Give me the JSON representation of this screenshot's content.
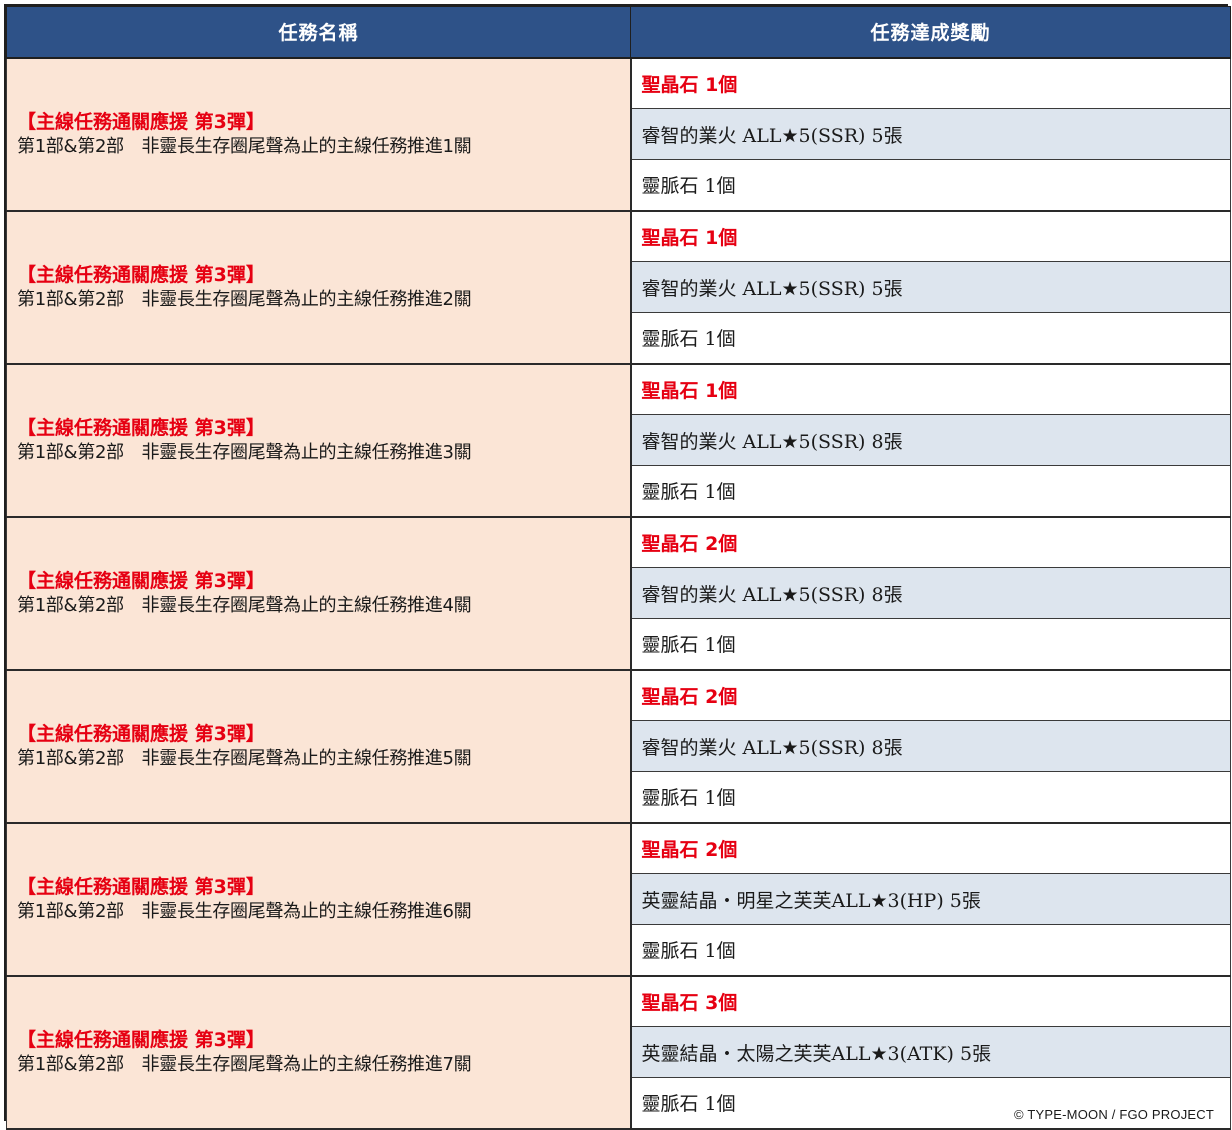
{
  "header": {
    "mission_name": "任務名稱",
    "reward": "任務達成獎勵"
  },
  "missions": [
    {
      "title": "【主線任務通關應援 第3彈】",
      "desc": "第1部&第2部　非靈長生存圈尾聲為止的主線任務推進1關",
      "rewards": [
        "聖晶石 1個",
        "睿智的業火 ALL★5(SSR) 5張",
        "靈脈石 1個"
      ]
    },
    {
      "title": "【主線任務通關應援 第3彈】",
      "desc": "第1部&第2部　非靈長生存圈尾聲為止的主線任務推進2關",
      "rewards": [
        "聖晶石 1個",
        "睿智的業火 ALL★5(SSR) 5張",
        "靈脈石 1個"
      ]
    },
    {
      "title": "【主線任務通關應援 第3彈】",
      "desc": "第1部&第2部　非靈長生存圈尾聲為止的主線任務推進3關",
      "rewards": [
        "聖晶石 1個",
        "睿智的業火 ALL★5(SSR) 8張",
        "靈脈石 1個"
      ]
    },
    {
      "title": "【主線任務通關應援 第3彈】",
      "desc": "第1部&第2部　非靈長生存圈尾聲為止的主線任務推進4關",
      "rewards": [
        "聖晶石 2個",
        "睿智的業火 ALL★5(SSR) 8張",
        "靈脈石 1個"
      ]
    },
    {
      "title": "【主線任務通關應援 第3彈】",
      "desc": "第1部&第2部　非靈長生存圈尾聲為止的主線任務推進5關",
      "rewards": [
        "聖晶石 2個",
        "睿智的業火 ALL★5(SSR) 8張",
        "靈脈石 1個"
      ]
    },
    {
      "title": "【主線任務通關應援 第3彈】",
      "desc": "第1部&第2部　非靈長生存圈尾聲為止的主線任務推進6關",
      "rewards": [
        "聖晶石 2個",
        "英靈結晶・明星之芙芙ALL★3(HP) 5張",
        "靈脈石 1個"
      ]
    },
    {
      "title": "【主線任務通關應援 第3彈】",
      "desc": "第1部&第2部　非靈長生存圈尾聲為止的主線任務推進7關",
      "rewards": [
        "聖晶石 3個",
        "英靈結晶・太陽之芙芙ALL★3(ATK) 5張",
        "靈脈石 1個"
      ]
    }
  ],
  "copyright": "© TYPE-MOON / FGO PROJECT",
  "colors": {
    "header_bg": "#2e5288",
    "name_cell_bg": "#fbe5d6",
    "highlight_text": "#e60012",
    "alt_row_bg": "#dde5ee"
  }
}
